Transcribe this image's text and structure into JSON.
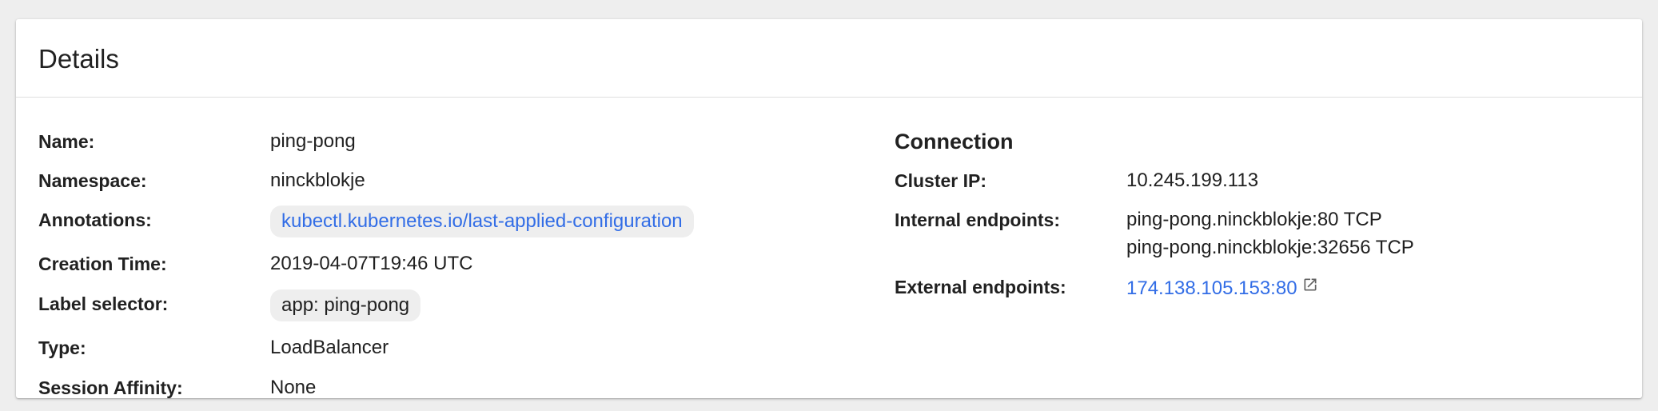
{
  "card": {
    "title": "Details"
  },
  "details": {
    "name_label": "Name:",
    "name_value": "ping-pong",
    "namespace_label": "Namespace:",
    "namespace_value": "ninckblokje",
    "annotations_label": "Annotations:",
    "annotations_chip": "kubectl.kubernetes.io/last-applied-configuration",
    "creation_label": "Creation Time:",
    "creation_value": "2019-04-07T19:46 UTC",
    "selector_label": "Label selector:",
    "selector_chip": "app: ping-pong",
    "type_label": "Type:",
    "type_value": "LoadBalancer",
    "affinity_label": "Session Affinity:",
    "affinity_value": "None"
  },
  "connection": {
    "title": "Connection",
    "cluster_ip_label": "Cluster IP:",
    "cluster_ip_value": "10.245.199.113",
    "internal_label": "Internal endpoints:",
    "internal_endpoints": [
      "ping-pong.ninckblokje:80 TCP",
      "ping-pong.ninckblokje:32656 TCP"
    ],
    "external_label": "External endpoints:",
    "external_endpoint": "174.138.105.153:80",
    "external_icon": "open-in-new-icon"
  },
  "colors": {
    "link": "#326de6",
    "chip_bg": "#eeeeee",
    "text": "#212121",
    "background": "#eeeeee"
  }
}
